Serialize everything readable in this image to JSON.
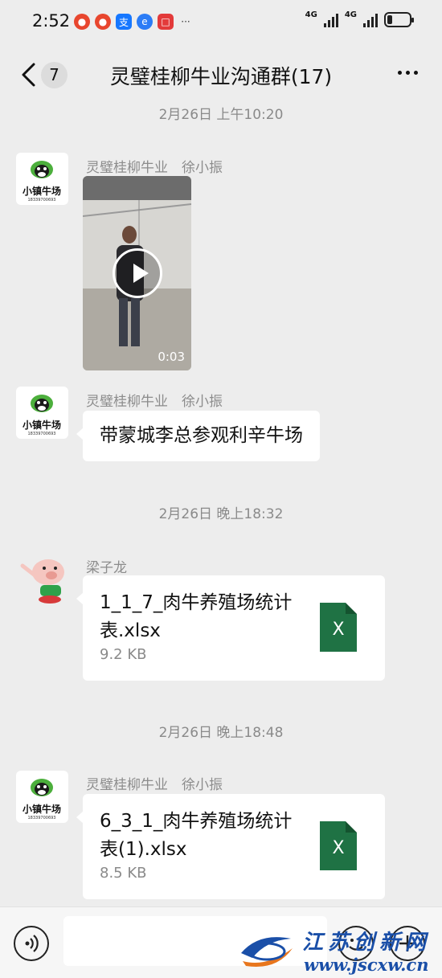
{
  "status_bar": {
    "time": "2:52",
    "network_1": "4G",
    "network_2": "4G"
  },
  "header": {
    "back_count": "7",
    "title": "灵璧桂柳牛业沟通群(17)"
  },
  "messages": [
    {
      "timestamp": "2月26日 上午10:20",
      "sender": "灵璧桂柳牛业　徐小振",
      "type": "video",
      "duration": "0:03"
    },
    {
      "sender": "灵璧桂柳牛业　徐小振",
      "type": "text",
      "text": "带蒙城李总参观利辛牛场"
    },
    {
      "timestamp": "2月26日 晚上18:32",
      "sender": "梁子龙",
      "type": "file",
      "file_name": "1_1_7_肉牛养殖场统计表.xlsx",
      "file_size": "9.2 KB",
      "file_type": "X"
    },
    {
      "timestamp": "2月26日 晚上18:48",
      "sender": "灵璧桂柳牛业　徐小振",
      "type": "file",
      "file_name": "6_3_1_肉牛养殖场统计表(1).xlsx",
      "file_size": "8.5 KB",
      "file_type": "X"
    }
  ],
  "avatar_logo": {
    "brand": "小镇牛场",
    "phone": "18339700693"
  },
  "watermark": {
    "name": "江苏创新网",
    "url": "www.jscxw.cn"
  },
  "colors": {
    "background": "#ededed",
    "excel": "#1f7244",
    "watermark": "#1a4fa8"
  }
}
